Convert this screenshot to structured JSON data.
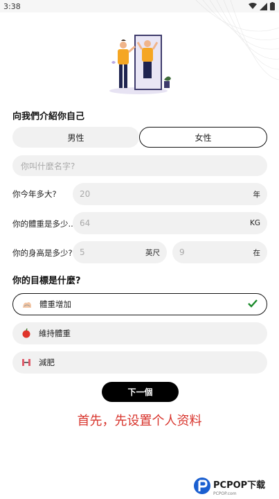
{
  "status": {
    "time": "3:38"
  },
  "colors": {
    "accent": "#000000",
    "promo": "#d8342c",
    "field_bg": "#f1f1f1",
    "figure_shirt": "#f5a623"
  },
  "intro": {
    "title": "向我們介紹你自己",
    "gender": {
      "male": "男性",
      "female": "女性",
      "selected": "female"
    },
    "name_placeholder": "你叫什麼名字?"
  },
  "age": {
    "label": "你今年多大?",
    "value": "20",
    "unit": "年"
  },
  "weight": {
    "label": "你的體重是多少...",
    "value": "64",
    "unit": "KG"
  },
  "height": {
    "label": "你的身高是多少?",
    "feet_value": "5",
    "feet_unit": "英尺",
    "inch_value": "9",
    "inch_unit": "在"
  },
  "goals": {
    "title": "你的目標是什麼?",
    "items": [
      {
        "label": "體重增加",
        "icon": "weight-gain-icon",
        "selected": true
      },
      {
        "label": "維持體重",
        "icon": "apple-icon",
        "selected": false
      },
      {
        "label": "減肥",
        "icon": "dumbbell-icon",
        "selected": false
      }
    ]
  },
  "next_button": "下一個",
  "promo_text": "首先，先设置个人资料",
  "watermark": {
    "brand": "PCPOP下载",
    "sub": "PCPOP.com"
  }
}
